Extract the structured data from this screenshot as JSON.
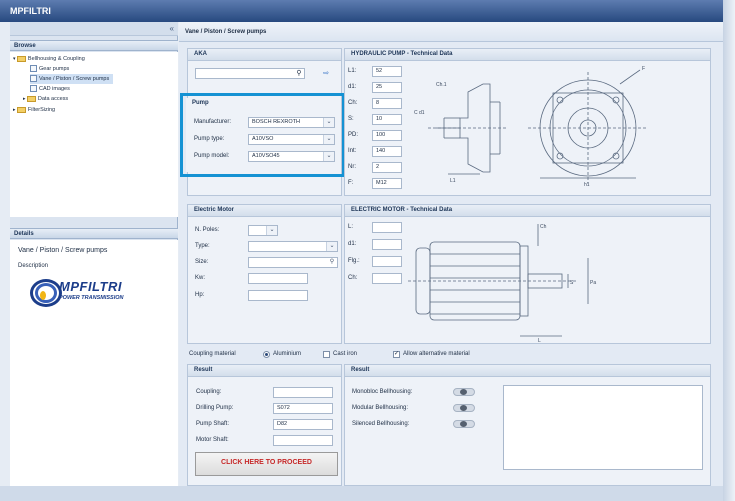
{
  "app": {
    "title": "MPFILTRI"
  },
  "sidebar": {
    "collapse_glyph": "«",
    "browse_title": "Browse",
    "tree": [
      {
        "label": "Bellhousing & Coupling",
        "icon": "folder-icon",
        "expanded": true
      },
      {
        "label": "Gear pumps",
        "icon": "document-icon"
      },
      {
        "label": "Vane / Piston / Screw pumps",
        "icon": "document-icon",
        "selected": true
      },
      {
        "label": "CAD images",
        "icon": "document-icon"
      },
      {
        "label": "Data access",
        "icon": "folder-icon"
      },
      {
        "label": "FilterSizing",
        "icon": "folder-icon"
      }
    ],
    "details_title": "Details",
    "details_heading": "Vane / Piston / Screw pumps",
    "details_description_label": "Description",
    "logo_text": "MPFILTRI",
    "logo_subtext": "POWER TRANSMISSION"
  },
  "breadcrumb": "Vane / Piston / Screw pumps",
  "aka": {
    "title": "AKA",
    "value": "",
    "search_icon": "search-icon",
    "export_icon": "export-icon"
  },
  "pump": {
    "title": "Pump",
    "manufacturer_label": "Manufacturer:",
    "manufacturer_value": "BOSCH REXROTH",
    "type_label": "Pump type:",
    "type_value": "A10VSO",
    "model_label": "Pump model:",
    "model_value": "A10VSO45"
  },
  "hydraulic": {
    "title": "HYDRAULIC PUMP - Technical Data",
    "fields": [
      {
        "label": "L1:",
        "value": "52"
      },
      {
        "label": "d1:",
        "value": "25"
      },
      {
        "label": "Ch:",
        "value": "8"
      },
      {
        "label": "S:",
        "value": "10"
      },
      {
        "label": "PD:",
        "value": "100"
      },
      {
        "label": "Int:",
        "value": "140"
      },
      {
        "label": "Nr:",
        "value": "2"
      },
      {
        "label": "F:",
        "value": "M12"
      }
    ],
    "drawing_labels": {
      "ch1": "Ch.1",
      "cd": "C d1",
      "l1": "L1",
      "h1": "h1",
      "f": "F"
    }
  },
  "motor": {
    "title": "Electric Motor",
    "poles_label": "N. Poles:",
    "poles_value": "",
    "type_label": "Type:",
    "type_value": "",
    "size_label": "Size:",
    "size_value": "",
    "kw_label": "Kw:",
    "kw_value": "",
    "hp_label": "Hp:",
    "hp_value": ""
  },
  "motor_tech": {
    "title": "ELECTRIC MOTOR - Technical Data",
    "fields": [
      {
        "label": "L:",
        "value": ""
      },
      {
        "label": "d1:",
        "value": ""
      },
      {
        "label": "Flg.:",
        "value": ""
      },
      {
        "label": "Ch:",
        "value": ""
      }
    ],
    "drawing_labels": {
      "ch": "Ch",
      "s": "S",
      "pa": "Pa",
      "l": "L"
    }
  },
  "coupling": {
    "label": "Coupling material",
    "aluminium": "Aluminium",
    "cast_iron": "Cast iron",
    "allow_alt": "Allow alternative material"
  },
  "result_left": {
    "title": "Result",
    "coupling_label": "Coupling:",
    "coupling_value": "",
    "drilling_label": "Drilling Pump:",
    "drilling_value": "S072",
    "pump_shaft_label": "Pump Shaft:",
    "pump_shaft_value": "D82",
    "motor_shaft_label": "Motor Shaft:",
    "motor_shaft_value": "",
    "proceed_label": "CLICK HERE TO PROCEED"
  },
  "result_right": {
    "title": "Result",
    "monobloc_label": "Monobloc Bellhousing:",
    "modular_label": "Modular Bellhousing:",
    "silenced_label": "Silenced Bellhousing:"
  },
  "colors": {
    "titlebar": "#27497f",
    "highlight": "#1592d3",
    "proceed_text": "#c62828"
  }
}
